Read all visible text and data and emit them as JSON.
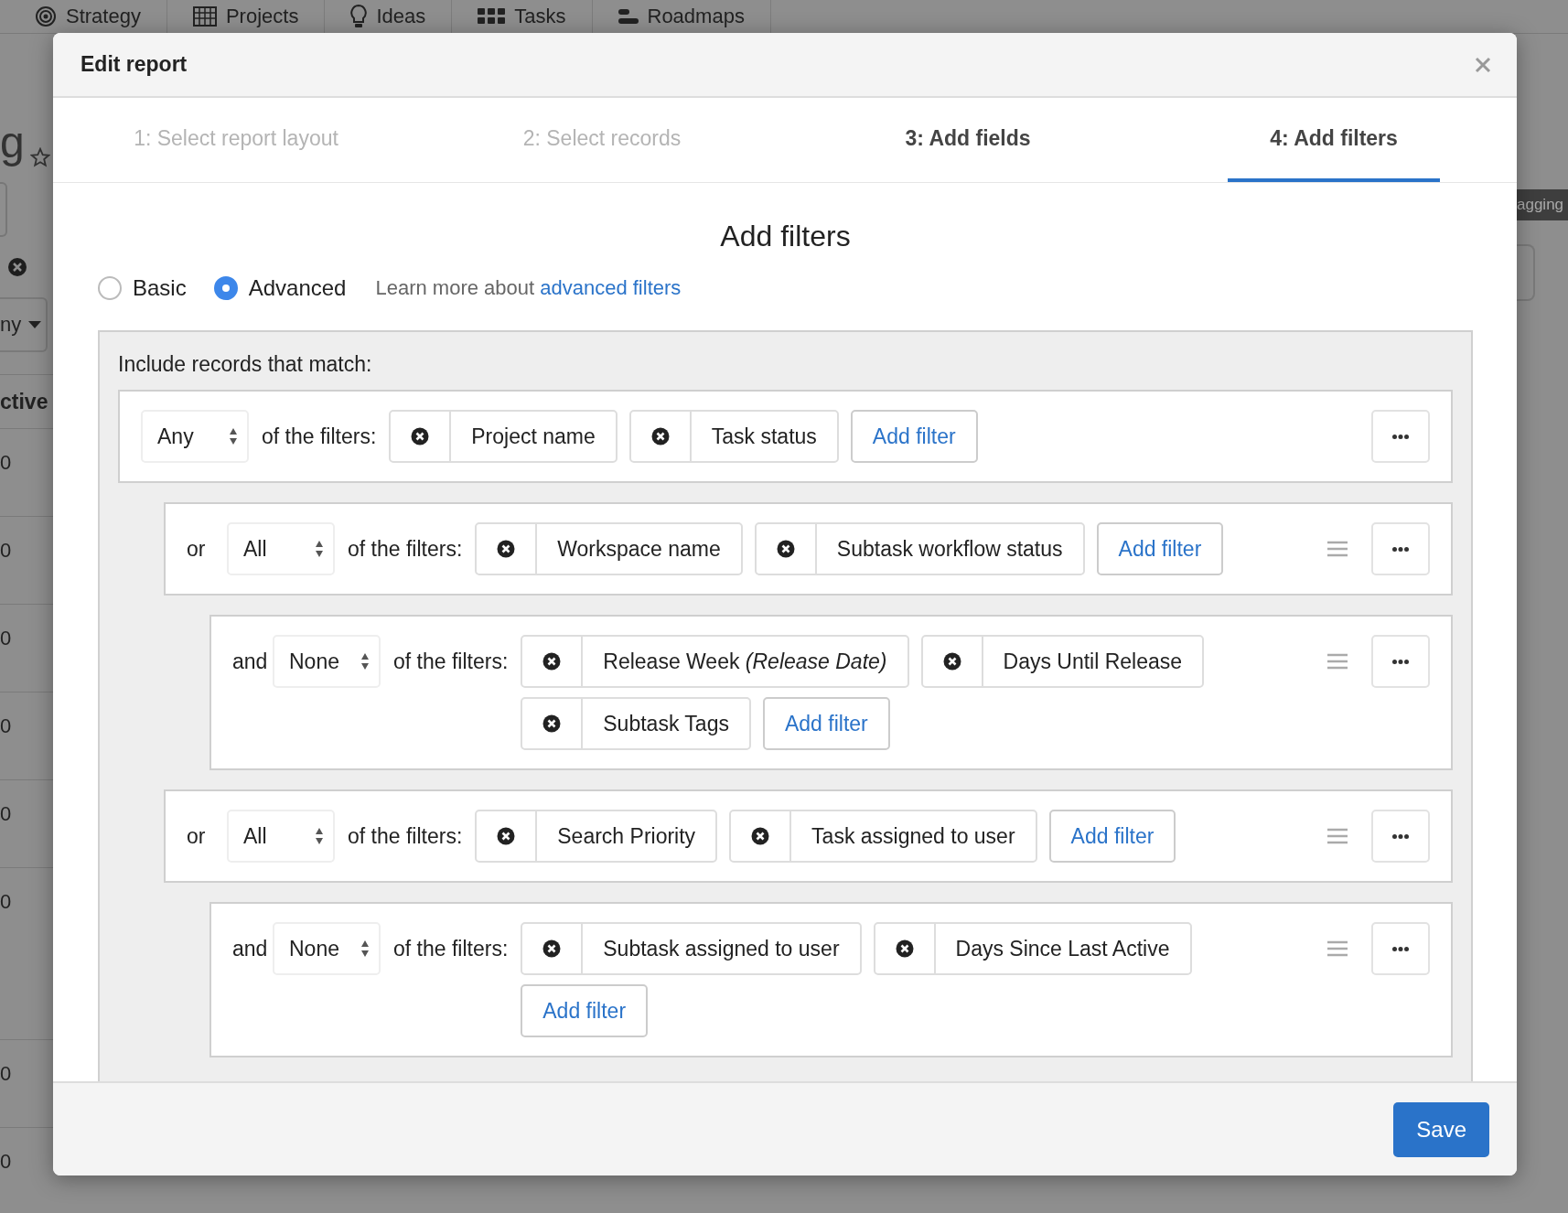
{
  "background": {
    "nav": [
      "Strategy",
      "Projects",
      "Ideas",
      "Tasks",
      "Roadmaps"
    ],
    "title_fragment": "g",
    "select_fragment": "ny",
    "column_fragment": "ctive",
    "cells": [
      "0",
      "0",
      "0",
      "0",
      "0",
      "0",
      "0",
      "0"
    ],
    "tag_fragment": "agging"
  },
  "dialog": {
    "title": "Edit report",
    "steps": [
      {
        "label": "1: Select report layout",
        "selected": false,
        "disabled": true
      },
      {
        "label": "2: Select records",
        "selected": false,
        "disabled": true
      },
      {
        "label": "3: Add fields",
        "selected": false,
        "disabled": false
      },
      {
        "label": "4: Add filters",
        "selected": true,
        "disabled": false
      }
    ],
    "heading": "Add filters",
    "modes": [
      {
        "label": "Basic",
        "selected": false
      },
      {
        "label": "Advanced",
        "selected": true
      }
    ],
    "help": {
      "text": "Learn more about",
      "link": "advanced filters"
    },
    "panel_label": "Include records that match:",
    "groups": [
      {
        "match": "Any",
        "lead": "of the filters:",
        "filters": [
          "Project name",
          "Task status"
        ],
        "add": "Add filter",
        "children": [
          {
            "connector": "or",
            "match": "All",
            "lead": "of the filters:",
            "filters": [
              "Workspace name",
              "Subtask workflow status"
            ],
            "add": "Add filter",
            "children": [
              {
                "connector": "and",
                "match": "None",
                "lead": "of the filters:",
                "filters": [
                  "Release Week *(Release Date)*",
                  "Days Until Release",
                  "Subtask Tags"
                ],
                "add": "Add filter"
              }
            ]
          },
          {
            "connector": "or",
            "match": "All",
            "lead": "of the filters:",
            "filters": [
              "Search Priority",
              "Task assigned to user"
            ],
            "add": "Add filter",
            "children": [
              {
                "connector": "and",
                "match": "None",
                "lead": "of the filters:",
                "filters": [
                  "Subtask assigned to user",
                  "Days Since Last Active"
                ],
                "add": "Add filter"
              }
            ]
          }
        ]
      }
    ],
    "save": "Save"
  }
}
